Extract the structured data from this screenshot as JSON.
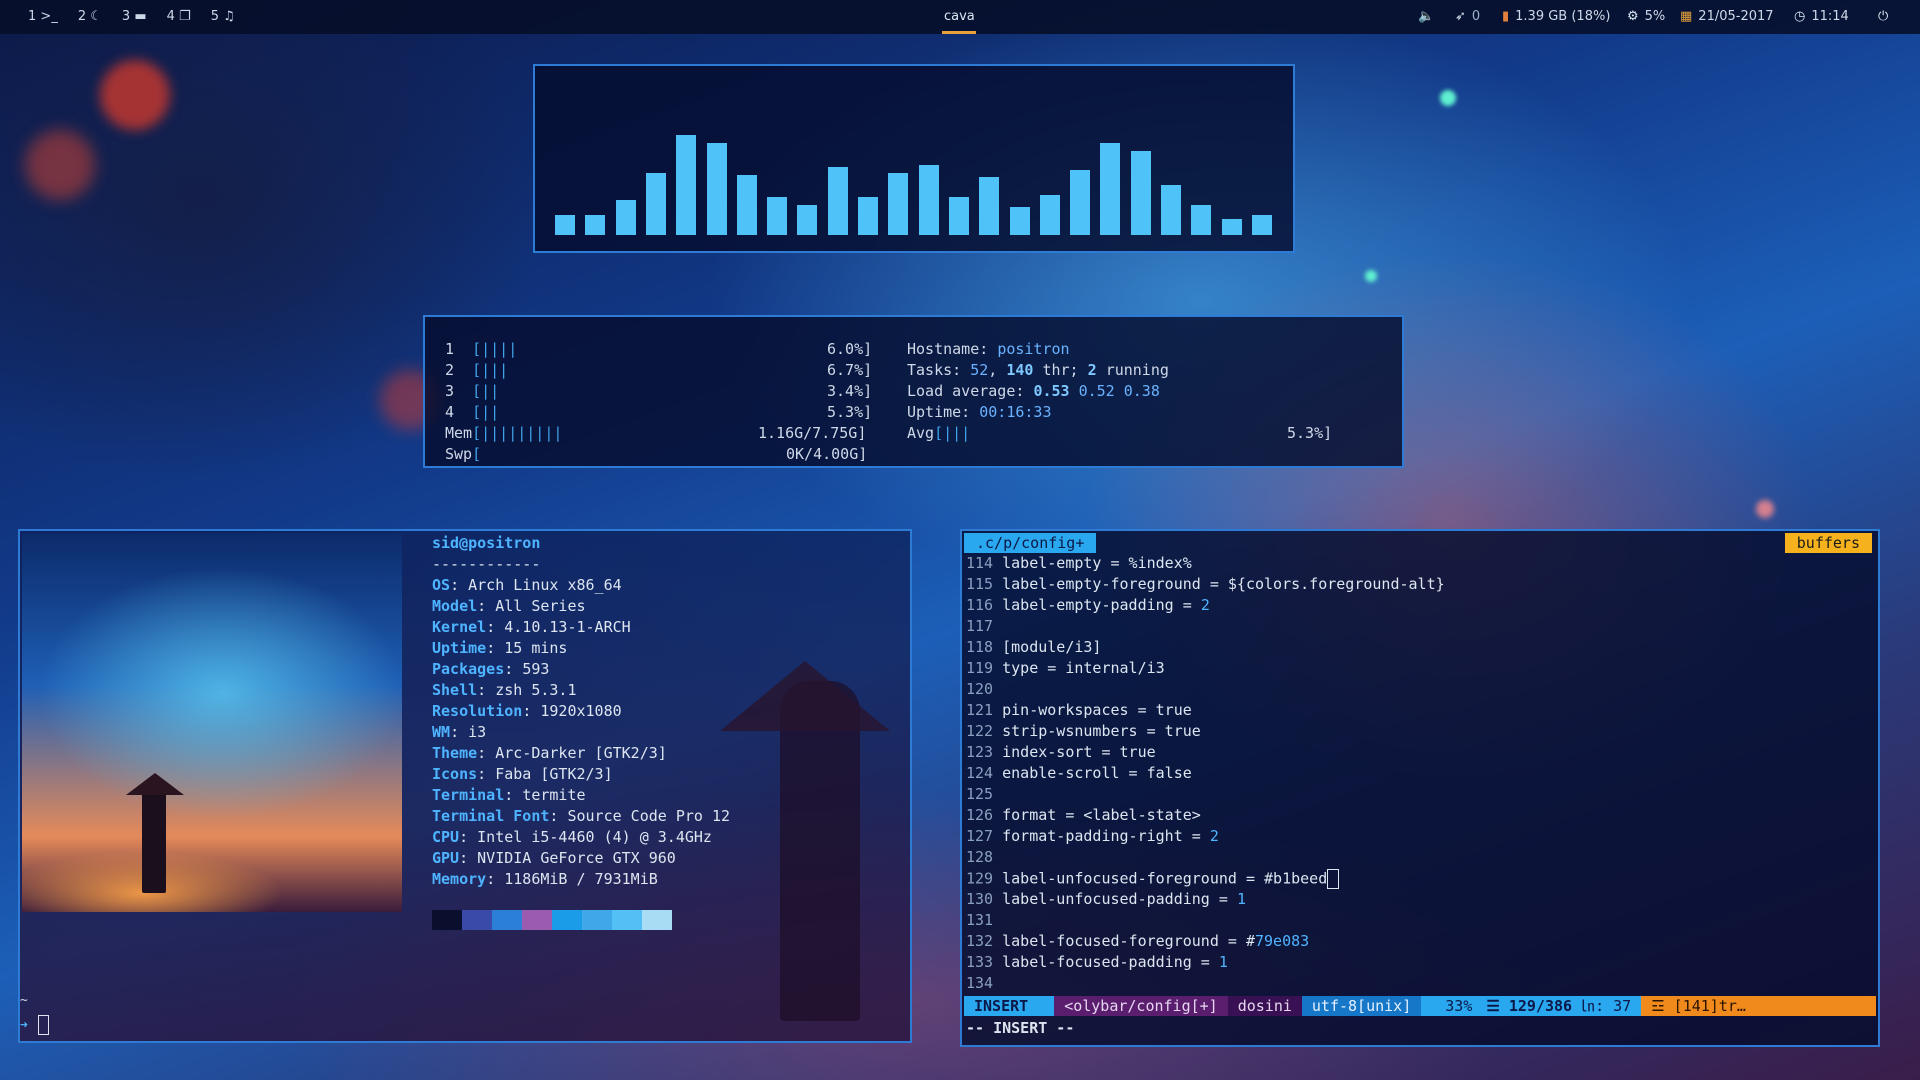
{
  "topbar": {
    "workspaces": [
      {
        "num": "1",
        "icon": ">_"
      },
      {
        "num": "2",
        "icon": "☾"
      },
      {
        "num": "3",
        "icon": "▬"
      },
      {
        "num": "4",
        "icon": "❐"
      },
      {
        "num": "5",
        "icon": "♫"
      }
    ],
    "window_title": "cava",
    "volume_icon": "speaker-icon",
    "updates": "0",
    "memory": "1.39 GB (18%)",
    "cpu": "5%",
    "date": "21/05-2017",
    "time": "11:14",
    "power_icon": "power-icon"
  },
  "cava": {
    "levels": [
      0.2,
      0.2,
      0.35,
      0.62,
      1.0,
      0.92,
      0.6,
      0.38,
      0.3,
      0.68,
      0.38,
      0.62,
      0.7,
      0.38,
      0.58,
      0.28,
      0.4,
      0.65,
      0.92,
      0.84,
      0.5,
      0.3,
      0.16,
      0.2
    ],
    "color": "#4fc3f7"
  },
  "htop": {
    "cpu": [
      {
        "id": "1",
        "bar": "[||||",
        "pct": "6.0%]"
      },
      {
        "id": "2",
        "bar": "[|||",
        "pct": "6.7%]"
      },
      {
        "id": "3",
        "bar": "[||",
        "pct": "3.4%]"
      },
      {
        "id": "4",
        "bar": "[||",
        "pct": "5.3%]"
      }
    ],
    "mem_label": "Mem",
    "mem_bar": "[|||||||||",
    "mem_val": "1.16G/7.75G]",
    "swp_label": "Swp",
    "swp_bar": "[",
    "swp_val": "0K/4.00G]",
    "hostname_label": "Hostname:",
    "hostname": "positron",
    "tasks_label": "Tasks:",
    "tasks": "52",
    "tasks_sep": ",",
    "threads": "140",
    "thr_label": "thr;",
    "running": "2",
    "running_label": "running",
    "load_label": "Load average:",
    "load1": "0.53",
    "load5": "0.52",
    "load15": "0.38",
    "uptime_label": "Uptime:",
    "uptime": "00:16:33",
    "avg_label": "Avg",
    "avg_bar": "[|||",
    "avg_val": "5.3%]"
  },
  "neofetch": {
    "userhost": "sid@positron",
    "sep": "------------",
    "rows": [
      {
        "k": "OS",
        "v": "Arch Linux x86_64"
      },
      {
        "k": "Model",
        "v": "All Series"
      },
      {
        "k": "Kernel",
        "v": "4.10.13-1-ARCH"
      },
      {
        "k": "Uptime",
        "v": "15 mins"
      },
      {
        "k": "Packages",
        "v": "593"
      },
      {
        "k": "Shell",
        "v": "zsh 5.3.1"
      },
      {
        "k": "Resolution",
        "v": "1920x1080"
      },
      {
        "k": "WM",
        "v": "i3"
      },
      {
        "k": "Theme",
        "v": "Arc-Darker [GTK2/3]"
      },
      {
        "k": "Icons",
        "v": "Faba [GTK2/3]"
      },
      {
        "k": "Terminal",
        "v": "termite"
      },
      {
        "k": "Terminal Font",
        "v": "Source Code Pro 12"
      },
      {
        "k": "CPU",
        "v": "Intel i5-4460 (4) @ 3.4GHz"
      },
      {
        "k": "GPU",
        "v": "NVIDIA GeForce GTX 960"
      },
      {
        "k": "Memory",
        "v": "1186MiB / 7931MiB"
      }
    ],
    "swatches": [
      "#0a0f2e",
      "#3a4aa8",
      "#2b7fd6",
      "#9b5cb0",
      "#1a9ce8",
      "#40a8e8",
      "#52c0f5",
      "#a8dcf5"
    ],
    "prompt_tilde": "~",
    "prompt_arrow": "➜"
  },
  "vim": {
    "tab_left": ".c/p/config+",
    "tab_right": "buffers",
    "lines": [
      {
        "n": "114",
        "t": "label-empty = %index%"
      },
      {
        "n": "115",
        "t": "label-empty-foreground = ${colors.foreground-alt}"
      },
      {
        "n": "116",
        "t": "label-empty-padding = ",
        "num": "2"
      },
      {
        "n": "117",
        "t": ""
      },
      {
        "n": "118",
        "t": "[module/i3]"
      },
      {
        "n": "119",
        "t": "type = internal/i3"
      },
      {
        "n": "120",
        "t": ""
      },
      {
        "n": "121",
        "t": "pin-workspaces = true"
      },
      {
        "n": "122",
        "t": "strip-wsnumbers = true"
      },
      {
        "n": "123",
        "t": "index-sort = true"
      },
      {
        "n": "124",
        "t": "enable-scroll = false"
      },
      {
        "n": "125",
        "t": ""
      },
      {
        "n": "126",
        "t": "format = <label-state>"
      },
      {
        "n": "127",
        "t": "format-padding-right = ",
        "num": "2"
      },
      {
        "n": "128",
        "t": ""
      },
      {
        "n": "129",
        "t": "label-unfocused-foreground = #b1beed",
        "cursor": true
      },
      {
        "n": "130",
        "t": "label-unfocused-padding = ",
        "num": "1"
      },
      {
        "n": "131",
        "t": ""
      },
      {
        "n": "132",
        "t": "label-focused-foreground = #",
        "num": "79e083"
      },
      {
        "n": "133",
        "t": "label-focused-padding = ",
        "num": "1"
      },
      {
        "n": "134",
        "t": ""
      }
    ],
    "status": {
      "mode": "INSERT",
      "file": "<olybar/config[+]",
      "ft": "dosini",
      "enc": "utf-8[unix]",
      "pct": "33%",
      "pos": "129/386",
      "col": ": 37",
      "warn": "[141]tr…"
    },
    "cmdline": "-- INSERT --",
    "colors": {
      "mode": "#29a8f0",
      "file": "#5b1e6e",
      "ft": "#3a1054",
      "enc": "#1677c8",
      "pos": "#29a8f0",
      "warn": "#f08a1c"
    }
  }
}
